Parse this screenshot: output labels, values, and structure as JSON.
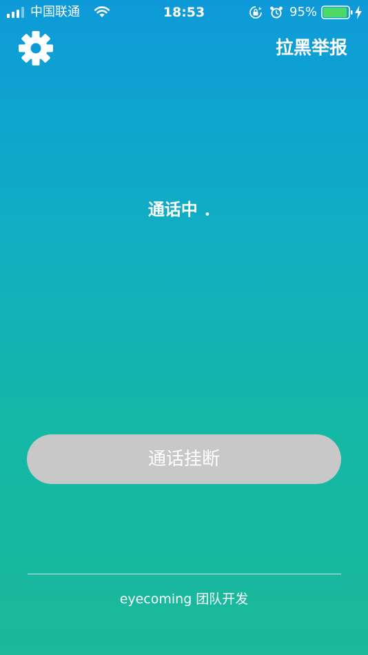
{
  "status_bar": {
    "carrier": "中国联通",
    "time": "18:53",
    "battery_percent": "95%",
    "battery_level": 0.95,
    "icons": [
      "signal-icon",
      "wifi-icon",
      "rotation-lock-icon",
      "alarm-icon",
      "battery-icon",
      "charging-bolt-icon"
    ]
  },
  "header": {
    "settings_icon": "gear-icon",
    "report_label": "拉黑举报"
  },
  "call": {
    "status_text": "通话中 ．"
  },
  "actions": {
    "hangup_label": "通话挂断"
  },
  "footer": {
    "credit": "eyecoming 团队开发"
  },
  "colors": {
    "gradient_top": "#0e9ad9",
    "gradient_bottom": "#1bb89a",
    "button_bg": "#c8c8c8",
    "battery_fill": "#4cd964"
  }
}
